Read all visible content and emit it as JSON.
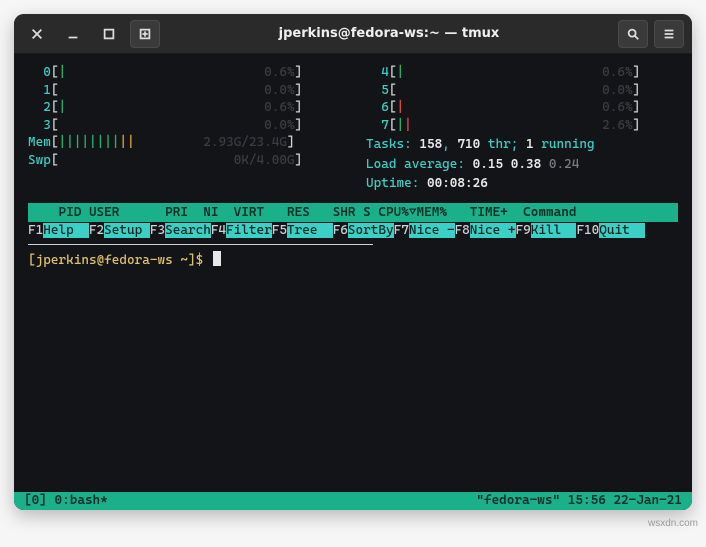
{
  "titlebar": {
    "title": "jperkins@fedora-ws:~ — tmux"
  },
  "cpu_meters_left": [
    {
      "label": "0",
      "bar_green": "|",
      "bar_red": "",
      "value": "0.6%"
    },
    {
      "label": "1",
      "bar_green": "",
      "bar_red": "",
      "value": "0.0%"
    },
    {
      "label": "2",
      "bar_green": "|",
      "bar_red": "",
      "value": "0.6%"
    },
    {
      "label": "3",
      "bar_green": "",
      "bar_red": "",
      "value": "0.0%"
    }
  ],
  "cpu_meters_right": [
    {
      "label": "4",
      "bar_green": "|",
      "bar_red": "",
      "value": "0.6%"
    },
    {
      "label": "5",
      "bar_green": "",
      "bar_red": "",
      "value": "0.0%"
    },
    {
      "label": "6",
      "bar_green": "",
      "bar_red": "|",
      "value": "0.6%"
    },
    {
      "label": "7",
      "bar_green": "|",
      "bar_red": "|",
      "value": "2.6%"
    }
  ],
  "mem": {
    "label": "Mem",
    "bar": "||||||||",
    "value": "2.93G/23.4G"
  },
  "swp": {
    "label": "Swp",
    "bar": "",
    "value": "0K/4.00G"
  },
  "tasks": {
    "label": "Tasks:",
    "procs": "158",
    "sep": ",",
    "thr": "710",
    "thr_label": "thr;",
    "running": "1",
    "running_label": "running"
  },
  "load": {
    "label": "Load average:",
    "v1": "0.15",
    "v2": "0.38",
    "v3": "0.24"
  },
  "uptime": {
    "label": "Uptime:",
    "value": "00:08:26"
  },
  "proc_header": "    PID USER      PRI  NI  VIRT   RES   SHR S CPU%▽MEM%   TIME+  Command",
  "fn_keys": [
    {
      "k": "F1",
      "label": "Help  "
    },
    {
      "k": "F2",
      "label": "Setup "
    },
    {
      "k": "F3",
      "label": "Search"
    },
    {
      "k": "F4",
      "label": "Filter"
    },
    {
      "k": "F5",
      "label": "Tree  "
    },
    {
      "k": "F6",
      "label": "SortBy"
    },
    {
      "k": "F7",
      "label": "Nice -"
    },
    {
      "k": "F8",
      "label": "Nice +"
    },
    {
      "k": "F9",
      "label": "Kill  "
    },
    {
      "k": "F10",
      "label": "Quit  "
    }
  ],
  "prompt": {
    "open": "[",
    "user": "jperkins",
    "at": "@",
    "host": "fedora-ws",
    "path": " ~",
    "close": "]",
    "sym": "$"
  },
  "tmux": {
    "left": "[0] 0:bash*",
    "right": "\"fedora-ws\" 15:56 22-Jan-21"
  },
  "watermark": "wsxdn.com"
}
